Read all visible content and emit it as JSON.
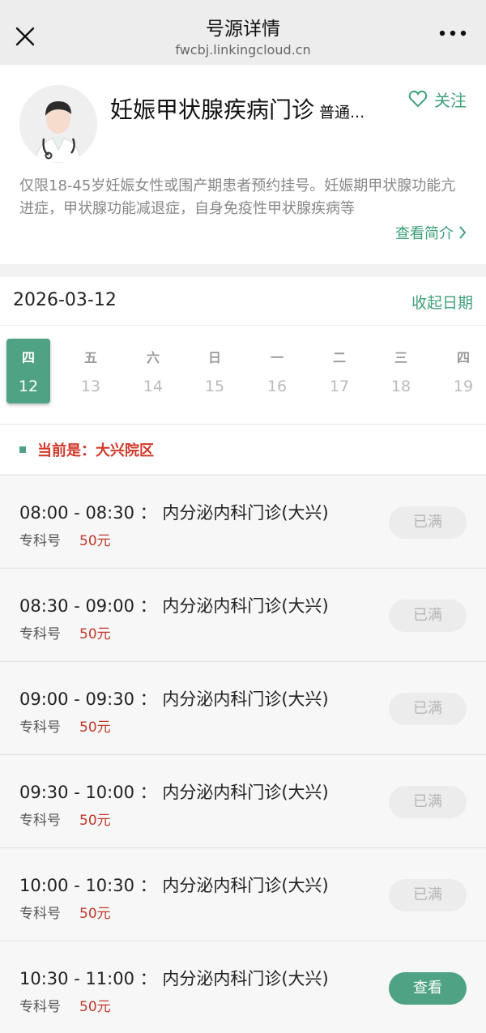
{
  "header": {
    "title": "号源详情",
    "url": "fwcbj.linkingcloud.cn"
  },
  "doctor": {
    "name": "妊娠甲状腺疾病门诊",
    "type": "普通...",
    "follow_label": "关注",
    "description": "仅限18-45岁妊娠女性或围产期患者预约挂号。妊娠期甲状腺功能亢进症，甲状腺功能减退症，自身免疫性甲状腺疾病等",
    "intro_label": "查看简介"
  },
  "date_bar": {
    "selected_date": "2026-03-12",
    "collapse_label": "收起日期"
  },
  "week": [
    {
      "weekday": "四",
      "day": "12",
      "active": true
    },
    {
      "weekday": "五",
      "day": "13"
    },
    {
      "weekday": "六",
      "day": "14"
    },
    {
      "weekday": "日",
      "day": "15"
    },
    {
      "weekday": "一",
      "day": "16"
    },
    {
      "weekday": "二",
      "day": "17"
    },
    {
      "weekday": "三",
      "day": "18"
    },
    {
      "weekday": "四",
      "day": "19"
    }
  ],
  "campus": {
    "label": "当前是：大兴院区"
  },
  "slots": [
    {
      "time": "08:00 - 08:30 ： 内分泌内科门诊(大兴)",
      "category": "专科号",
      "price": "50元",
      "button": "已满",
      "status": "full"
    },
    {
      "time": "08:30 - 09:00 ： 内分泌内科门诊(大兴)",
      "category": "专科号",
      "price": "50元",
      "button": "已满",
      "status": "full"
    },
    {
      "time": "09:00 - 09:30 ： 内分泌内科门诊(大兴)",
      "category": "专科号",
      "price": "50元",
      "button": "已满",
      "status": "full"
    },
    {
      "time": "09:30 - 10:00 ： 内分泌内科门诊(大兴)",
      "category": "专科号",
      "price": "50元",
      "button": "已满",
      "status": "full"
    },
    {
      "time": "10:00 - 10:30 ： 内分泌内科门诊(大兴)",
      "category": "专科号",
      "price": "50元",
      "button": "已满",
      "status": "full"
    },
    {
      "time": "10:30 - 11:00 ： 内分泌内科门诊(大兴)",
      "category": "专科号",
      "price": "50元",
      "button": "查看",
      "status": "available"
    }
  ],
  "colors": {
    "accent": "#4fa283",
    "price": "#c0392b",
    "campus": "#d0392b"
  }
}
